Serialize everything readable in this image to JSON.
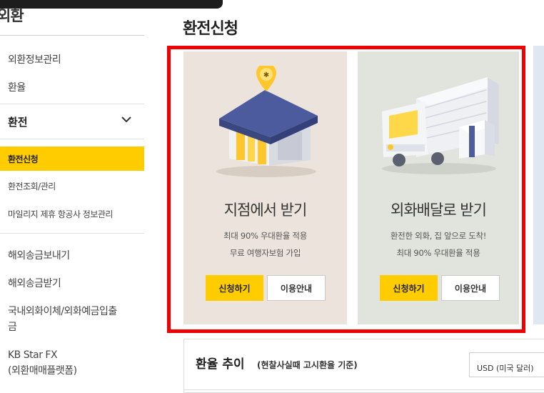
{
  "sidebar": {
    "title": "외환",
    "items": [
      {
        "label": "외환정보관리"
      },
      {
        "label": "환율"
      }
    ],
    "group": {
      "label": "환전",
      "sub_items": [
        {
          "label": "환전신청",
          "active": true
        },
        {
          "label": "환전조회/관리"
        },
        {
          "label": "마일리지 제휴 항공사 정보관리"
        }
      ]
    },
    "more_items": [
      {
        "label": "해외송금보내기"
      },
      {
        "label": "해외송금받기"
      },
      {
        "label_line1": "국내외화이체/외화예금입출",
        "label_line2": "금"
      },
      {
        "label_line1": "KB Star FX",
        "label_line2": "(외환매매플랫폼)"
      }
    ]
  },
  "main": {
    "title": "환전신청",
    "cards": [
      {
        "heading": "지점에서 받기",
        "desc": [
          "최대 90% 우대환율 적용",
          "무료 여행자보험 가입"
        ],
        "apply_label": "신청하기",
        "guide_label": "이용안내",
        "icon": "bank-building-icon"
      },
      {
        "heading": "외화배달로 받기",
        "desc": [
          "환전한 외화, 집 앞으로 도착!",
          "최대 90% 우대환율 적용"
        ],
        "apply_label": "신청하기",
        "guide_label": "이용안내",
        "icon": "delivery-truck-icon"
      }
    ],
    "trend": {
      "title": "환율 추이",
      "subtitle": "(현찰사실때 고시환율 기준)",
      "currency_selected": "USD (미국 달러)"
    }
  },
  "colors": {
    "accent": "#ffcc00",
    "highlight_frame": "#ee0000",
    "card_branch_bg": "#ece4dc",
    "card_delivery_bg": "#e1e4dd"
  }
}
